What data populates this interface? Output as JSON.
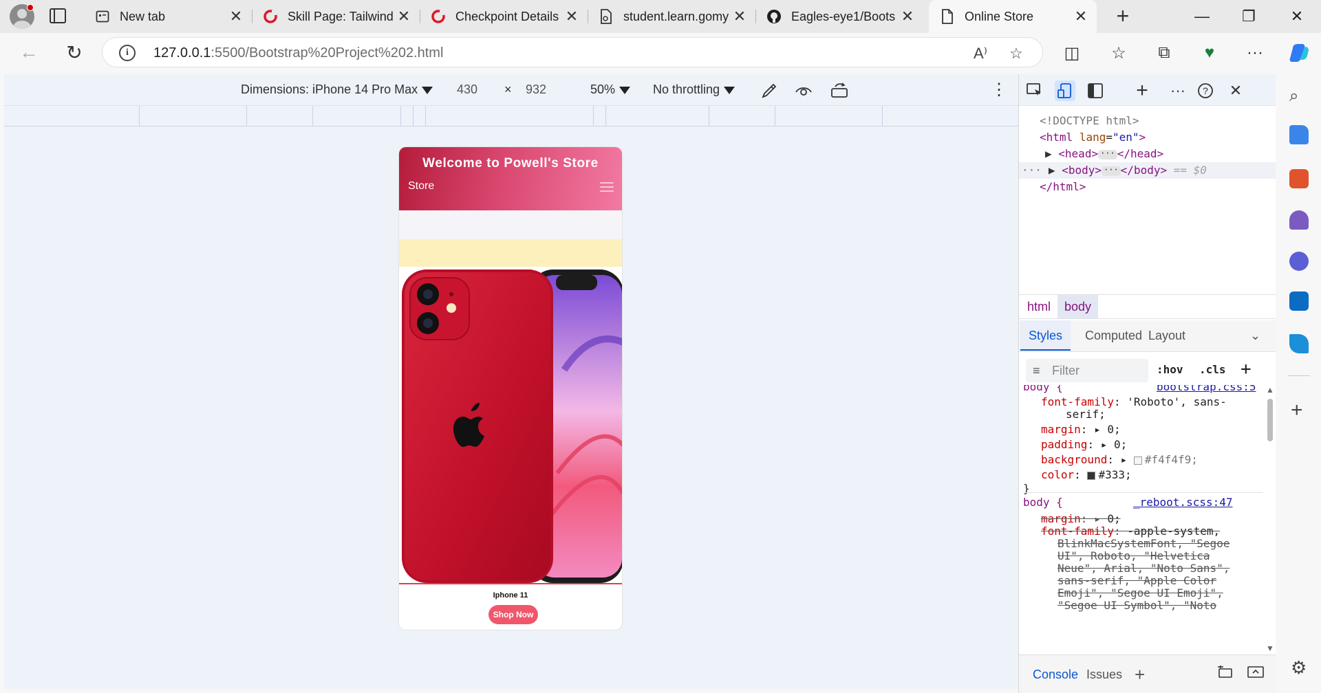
{
  "browser": {
    "tabs": [
      {
        "label": "New tab",
        "icon": "new-tab-page-icon",
        "close": "✕"
      },
      {
        "label": "Skill Page: Tailwind",
        "icon": "gomycode-icon",
        "close": "✕"
      },
      {
        "label": "Checkpoint Details",
        "icon": "gomycode-icon",
        "close": "✕"
      },
      {
        "label": "student.learn.gomy",
        "icon": "document-icon",
        "close": "✕"
      },
      {
        "label": "Eagles-eye1/Boots",
        "icon": "github-icon",
        "close": "✕"
      },
      {
        "label": "Online Store",
        "icon": "page-icon",
        "close": "✕",
        "active": true
      }
    ],
    "newtab": "+",
    "window": {
      "minimize": "—",
      "restore": "❐",
      "close": "✕"
    },
    "address": {
      "host": "127.0.0.1",
      "path": ":5500/Bootstrap%20Project%202.html"
    },
    "nav": {
      "back": "←",
      "reload": "↻"
    },
    "toolbar_icons": {
      "read_aloud": "A⁾",
      "favorite": "☆",
      "split": "◫",
      "favorites": "☆",
      "collections": "⧉",
      "health": "♥",
      "more": "···"
    }
  },
  "device_toolbar": {
    "dimensions_label": "Dimensions: iPhone 14 Pro Max",
    "width": "430",
    "times": "×",
    "height": "932",
    "zoom": "50%",
    "throttling": "No throttling",
    "more": "⋮"
  },
  "emulated_page": {
    "header_title": "Welcome to Powell's Store",
    "brand": "Store",
    "product_name": "Iphone 11",
    "shop_button": "Shop Now",
    "colors": {
      "header_start": "#b51c3b",
      "header_end": "#f27aa3",
      "promo_strip": "#fdf0bd",
      "button": "#f0576c",
      "phone_red": "#c8102e"
    }
  },
  "devtools": {
    "dom": {
      "doctype": "<!DOCTYPE html>",
      "html_open_tag": "<html",
      "html_attr": "lang",
      "html_attr_value": "\"en\"",
      "head_open": "<head>",
      "head_close": "</head>",
      "body_open": "<body>",
      "body_close": "</body>",
      "body_eq": "== $0",
      "html_close": "</html>",
      "ellipsis": "···",
      "gutter": "···"
    },
    "breadcrumbs": [
      "html",
      "body"
    ],
    "panel_tabs": [
      "Styles",
      "Computed",
      "Layout"
    ],
    "filter_placeholder": "Filter",
    "hov": ":hov",
    "cls": ".cls",
    "add": "+",
    "rules": {
      "rule1": {
        "selector_partial": "body {",
        "source": "bootstrap.css:5",
        "font_family_prop": "font-family",
        "font_family_val": "'Roboto', sans-",
        "font_family_val2": "serif;",
        "margin_prop": "margin",
        "margin_val": "0;",
        "padding_prop": "padding",
        "padding_val": "0;",
        "background_prop": "background",
        "background_val": "#f4f4f9;",
        "color_prop": "color",
        "color_val": "#333;",
        "close": "}"
      },
      "rule2": {
        "selector": "body {",
        "source": "_reboot.scss:47",
        "margin_prop": "margin",
        "margin_val": "0;",
        "font_family_prop": "font-family",
        "font_family_val": "-apple-system,",
        "lines": [
          "BlinkMacSystemFont, \"Segoe",
          "UI\", Roboto, \"Helvetica",
          "Neue\", Arial, \"Noto Sans\",",
          "sans-serif, \"Apple Color",
          "Emoji\", \"Segoe UI Emoji\",",
          "\"Segoe UI Symbol\", \"Noto"
        ]
      }
    },
    "swatches": {
      "background": "#f4f4f9",
      "color": "#333333"
    },
    "drawer_tabs": [
      "Console",
      "Issues"
    ],
    "drawer_add": "+"
  }
}
